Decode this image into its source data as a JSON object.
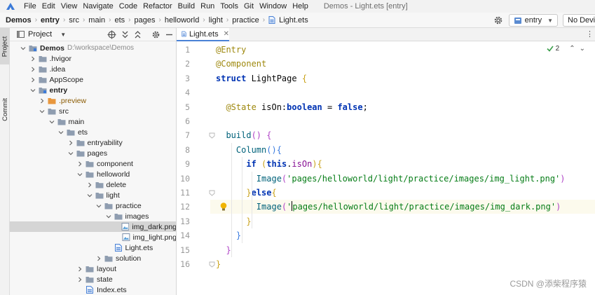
{
  "menubar": {
    "items": [
      "File",
      "Edit",
      "View",
      "Navigate",
      "Code",
      "Refactor",
      "Build",
      "Run",
      "Tools",
      "Git",
      "Window",
      "Help"
    ],
    "window_title": "Demos - Light.ets [entry]"
  },
  "breadcrumb": {
    "items": [
      "Demos",
      "entry",
      "src",
      "main",
      "ets",
      "pages",
      "helloworld",
      "light",
      "practice"
    ],
    "file": "Light.ets"
  },
  "run_config": {
    "label": "entry"
  },
  "device": {
    "label": "No Devices"
  },
  "tool_strip": {
    "project": "Project",
    "commit": "Commit"
  },
  "project_panel": {
    "title": "Project",
    "tree": [
      {
        "label": "Demos",
        "path": "D:\\workspace\\Demos",
        "depth": 0,
        "expanded": true,
        "kind": "module",
        "bold": true
      },
      {
        "label": ".hvigor",
        "depth": 1,
        "expanded": false,
        "kind": "folder"
      },
      {
        "label": ".idea",
        "depth": 1,
        "expanded": false,
        "kind": "folder"
      },
      {
        "label": "AppScope",
        "depth": 1,
        "expanded": false,
        "kind": "folder"
      },
      {
        "label": "entry",
        "depth": 1,
        "expanded": true,
        "kind": "module",
        "bold": true
      },
      {
        "label": ".preview",
        "depth": 2,
        "expanded": false,
        "kind": "folder-orange",
        "highlight": true
      },
      {
        "label": "src",
        "depth": 2,
        "expanded": true,
        "kind": "folder"
      },
      {
        "label": "main",
        "depth": 3,
        "expanded": true,
        "kind": "folder"
      },
      {
        "label": "ets",
        "depth": 4,
        "expanded": true,
        "kind": "folder"
      },
      {
        "label": "entryability",
        "depth": 5,
        "expanded": false,
        "kind": "folder"
      },
      {
        "label": "pages",
        "depth": 5,
        "expanded": true,
        "kind": "folder"
      },
      {
        "label": "component",
        "depth": 6,
        "expanded": false,
        "kind": "folder"
      },
      {
        "label": "helloworld",
        "depth": 6,
        "expanded": true,
        "kind": "folder"
      },
      {
        "label": "delete",
        "depth": 7,
        "expanded": false,
        "kind": "folder"
      },
      {
        "label": "light",
        "depth": 7,
        "expanded": true,
        "kind": "folder"
      },
      {
        "label": "practice",
        "depth": 8,
        "expanded": true,
        "kind": "folder"
      },
      {
        "label": "images",
        "depth": 9,
        "expanded": true,
        "kind": "folder"
      },
      {
        "label": "img_dark.png",
        "depth": 10,
        "kind": "image",
        "selected": true
      },
      {
        "label": "img_light.png",
        "depth": 10,
        "kind": "image"
      },
      {
        "label": "Light.ets",
        "depth": 9,
        "kind": "ets"
      },
      {
        "label": "solution",
        "depth": 8,
        "expanded": false,
        "kind": "folder"
      },
      {
        "label": "layout",
        "depth": 6,
        "expanded": false,
        "kind": "folder"
      },
      {
        "label": "state",
        "depth": 6,
        "expanded": false,
        "kind": "folder"
      },
      {
        "label": "Index.ets",
        "depth": 6,
        "kind": "ets"
      }
    ]
  },
  "editor": {
    "tab_label": "Light.ets",
    "inspection_count": "2",
    "lines": [
      {
        "n": "1",
        "tokens": [
          [
            "ann",
            "@Entry"
          ]
        ]
      },
      {
        "n": "2",
        "tokens": [
          [
            "ann",
            "@Component"
          ]
        ]
      },
      {
        "n": "3",
        "tokens": [
          [
            "kw",
            "struct"
          ],
          [
            "plain",
            " LightPage "
          ],
          [
            "brk-y",
            "{"
          ]
        ]
      },
      {
        "n": "4",
        "tokens": []
      },
      {
        "n": "5",
        "tokens": [
          [
            "plain",
            "  "
          ],
          [
            "ann",
            "@State"
          ],
          [
            "plain",
            " isOn:"
          ],
          [
            "kw",
            "boolean"
          ],
          [
            "plain",
            " = "
          ],
          [
            "kw",
            "false"
          ],
          [
            "plain",
            ";"
          ]
        ]
      },
      {
        "n": "6",
        "tokens": []
      },
      {
        "n": "7",
        "tokens": [
          [
            "plain",
            "  "
          ],
          [
            "fn",
            "build"
          ],
          [
            "brk-p",
            "()"
          ],
          [
            "plain",
            " "
          ],
          [
            "brk-p",
            "{"
          ]
        ]
      },
      {
        "n": "8",
        "tokens": [
          [
            "plain",
            "    "
          ],
          [
            "fn",
            "Column"
          ],
          [
            "brk-b",
            "()"
          ],
          [
            "brk-b",
            "{"
          ]
        ]
      },
      {
        "n": "9",
        "tokens": [
          [
            "plain",
            "      "
          ],
          [
            "kw",
            "if"
          ],
          [
            "plain",
            " "
          ],
          [
            "brk-y",
            "("
          ],
          [
            "kw",
            "this"
          ],
          [
            "plain",
            "."
          ],
          [
            "prop",
            "isOn"
          ],
          [
            "brk-y",
            ")"
          ],
          [
            "brk-y",
            "{"
          ]
        ]
      },
      {
        "n": "10",
        "tokens": [
          [
            "plain",
            "        "
          ],
          [
            "fn",
            "Image"
          ],
          [
            "brk-p",
            "("
          ],
          [
            "str",
            "'pages/helloworld/light/practice/images/img_light.png'"
          ],
          [
            "brk-p",
            ")"
          ]
        ]
      },
      {
        "n": "11",
        "tokens": [
          [
            "plain",
            "      "
          ],
          [
            "brk-y",
            "}"
          ],
          [
            "kw",
            "else"
          ],
          [
            "brk-y",
            "{"
          ]
        ]
      },
      {
        "n": "12",
        "tokens": [
          [
            "plain",
            "        "
          ],
          [
            "fn",
            "Image"
          ],
          [
            "brk-p",
            "("
          ],
          [
            "str",
            "'"
          ],
          [
            "caret",
            ""
          ],
          [
            "str",
            "pages/helloworld/light/practice/images/img_dark.png'"
          ],
          [
            "brk-p",
            ")"
          ]
        ],
        "current": true
      },
      {
        "n": "13",
        "tokens": [
          [
            "plain",
            "      "
          ],
          [
            "brk-y",
            "}"
          ]
        ]
      },
      {
        "n": "14",
        "tokens": [
          [
            "plain",
            "    "
          ],
          [
            "brk-b",
            "}"
          ]
        ]
      },
      {
        "n": "15",
        "tokens": [
          [
            "plain",
            "  "
          ],
          [
            "brk-p",
            "}"
          ]
        ]
      },
      {
        "n": "16",
        "tokens": [
          [
            "brk-y",
            "}"
          ]
        ]
      }
    ]
  },
  "watermark": "CSDN @添柴程序猿",
  "colors": {
    "accent": "#4a82d6",
    "selection": "#d5d5d5",
    "current_line": "#fcfaed",
    "folder": "#8f9db0",
    "folder_orange": "#e8973e"
  },
  "icons": {
    "logo": "huawei-deveco-logo",
    "gear": "gear-icon",
    "run_config": "module-icon",
    "bulb": "lightbulb-icon",
    "check": "check-icon"
  }
}
